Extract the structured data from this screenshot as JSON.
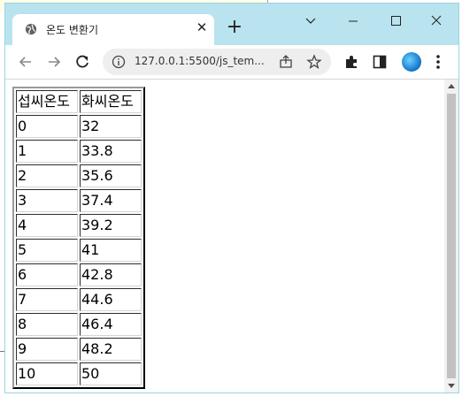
{
  "browser": {
    "tab": {
      "title": "온도 변환기",
      "close_glyph": "✕",
      "favicon": "globe-icon"
    },
    "new_tab_glyph": "+",
    "window_controls": [
      "chevron-down-icon",
      "minimize-icon",
      "maximize-icon",
      "close-icon"
    ],
    "nav": [
      "back-arrow-icon",
      "forward-arrow-icon",
      "reload-icon"
    ],
    "address_bar": {
      "url": "127.0.0.1:5500/js_tem...",
      "left_icon": "info-icon",
      "right_icons": [
        "share-icon",
        "star-icon"
      ]
    },
    "toolbar_icons": [
      "extensions-icon",
      "side-panel-icon",
      "profile-avatar",
      "menu-dots-icon"
    ],
    "colors": {
      "titlebar": "#b9e3ee",
      "tab": "#ffffff",
      "omnibox": "#eeeeee",
      "scroll_thumb": "#c1c1c1"
    }
  },
  "table": {
    "headers": [
      "섭씨온도",
      "화씨온도"
    ],
    "rows": [
      [
        "0",
        "32"
      ],
      [
        "1",
        "33.8"
      ],
      [
        "2",
        "35.6"
      ],
      [
        "3",
        "37.4"
      ],
      [
        "4",
        "39.2"
      ],
      [
        "5",
        "41"
      ],
      [
        "6",
        "42.8"
      ],
      [
        "7",
        "44.6"
      ],
      [
        "8",
        "46.4"
      ],
      [
        "9",
        "48.2"
      ],
      [
        "10",
        "50"
      ]
    ]
  }
}
